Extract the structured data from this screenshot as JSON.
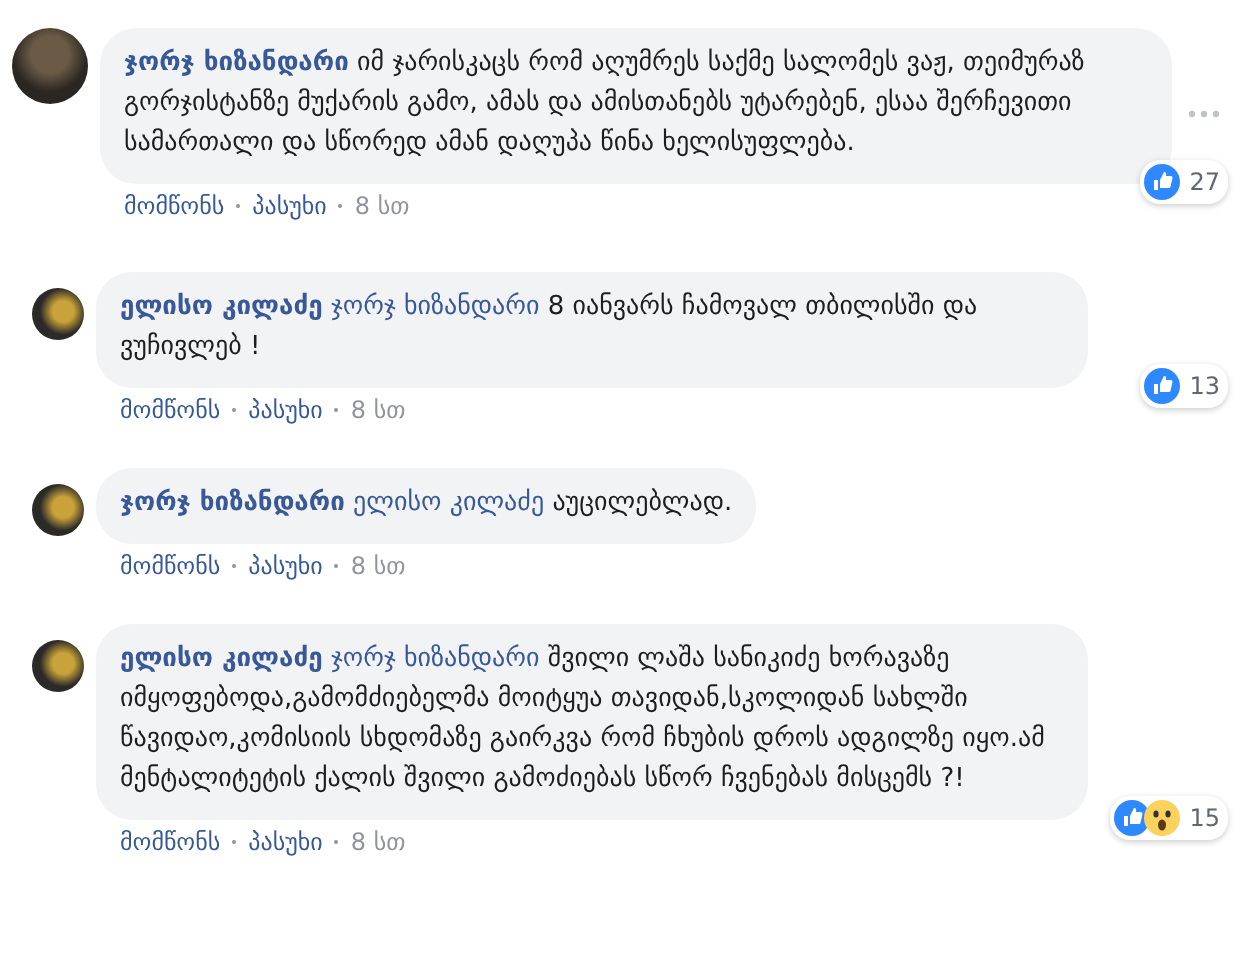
{
  "comments": [
    {
      "author": "ჯორჯ ხიზანდარი",
      "text": "იმ ჯარისკაცს რომ აღუმრეს საქმე სალომეს ვაჟ, თეიმურაზ გორჯისტანზე მუქარის გამო, ამას და ამისთანებს უტარებენ, ესაა შერჩევითი სამართალი და სწორედ ამან დაღუპა წინა ხელისუფლება.",
      "reactions": [
        {
          "kind": "like"
        }
      ],
      "reaction_count": "27",
      "actions": [
        "მომწონს",
        "პასუხი"
      ],
      "time": "8 სთ",
      "children": [
        {
          "author": "ელისო კილაძე",
          "mention": "ჯორჯ ხიზანდარი",
          "text": "8 იანვარს ჩამოვალ თბილისში და ვუჩივლებ !",
          "reactions": [
            {
              "kind": "like"
            }
          ],
          "reaction_count": "13",
          "actions": [
            "მომწონს",
            "პასუხი"
          ],
          "time": "8 სთ"
        },
        {
          "author": "ჯორჯ ხიზანდარი",
          "mention": "ელისო კილაძე",
          "text": "აუცილებლად.",
          "actions": [
            "მომწონს",
            "პასუხი"
          ],
          "time": "8 სთ"
        },
        {
          "author": "ელისო კილაძე",
          "mention": "ჯორჯ ხიზანდარი",
          "text": "შვილი ლაშა სანიკიძე ხორავაზე იმყოფებოდა,გამომძიებელმა მოიტყუა თავიდან,სკოლიდან სახლში წავიდაო,კომისიის სხდომაზე გაირკვა რომ ჩხუბის დროს ადგილზე იყო.ამ მენტალიტეტის ქალის შვილი გამოძიებას სწორ ჩვენებას მისცემს ?!",
          "reactions": [
            {
              "kind": "like"
            },
            {
              "kind": "wow"
            }
          ],
          "reaction_count": "15",
          "actions": [
            "მომწონს",
            "პასუხი"
          ],
          "time": "8 სთ"
        }
      ]
    }
  ]
}
